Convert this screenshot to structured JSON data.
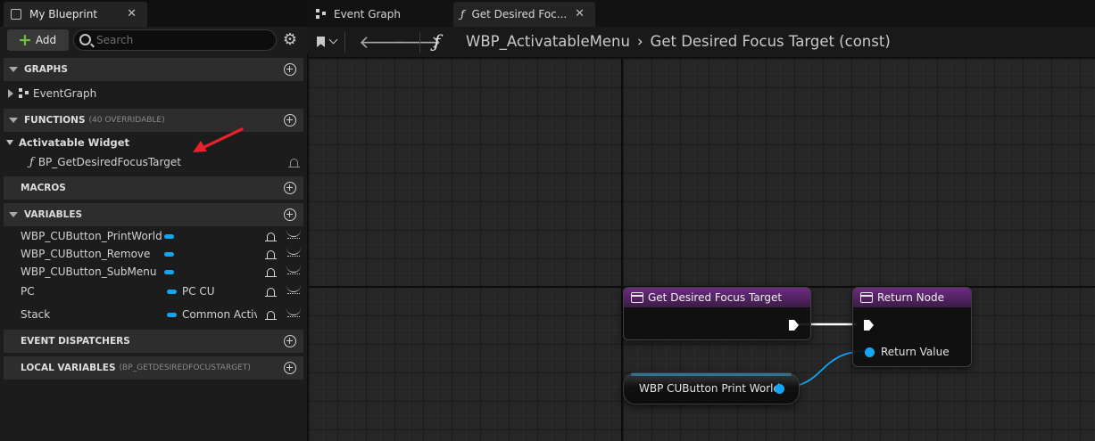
{
  "left_panel": {
    "tab_title": "My Blueprint",
    "tab_close": "✕",
    "add_label": "Add",
    "search_placeholder": "Search",
    "sections": {
      "graphs": {
        "title": "GRAPHS",
        "items": [
          "EventGraph"
        ]
      },
      "functions": {
        "title": "FUNCTIONS",
        "subtitle": "(40 OVERRIDABLE)",
        "category": "Activatable Widget",
        "items": [
          "BP_GetDesiredFocusTarget"
        ]
      },
      "macros": {
        "title": "MACROS"
      },
      "variables": {
        "title": "VARIABLES",
        "items": [
          {
            "name": "WBP_CUButton_PrintWorld",
            "type": ""
          },
          {
            "name": "WBP_CUButton_Remove",
            "type": ""
          },
          {
            "name": "WBP_CUButton_SubMenu",
            "type": ""
          },
          {
            "name": "PC",
            "type": "PC CU"
          },
          {
            "name": "Stack",
            "type": "Common Activ"
          }
        ]
      },
      "event_dispatchers": {
        "title": "EVENT DISPATCHERS"
      },
      "local_variables": {
        "title": "LOCAL VARIABLES",
        "subtitle": "(BP_GETDESIREDFOCUSTARGET)"
      }
    },
    "colors": {
      "annotation_arrow": "#e8222a",
      "variable_pill": "#12a6f2"
    }
  },
  "graph": {
    "tabs": [
      {
        "label": "Event Graph",
        "active": false
      },
      {
        "label": "Get Desired Foc...",
        "active": true
      }
    ],
    "tab_close": "✕",
    "breadcrumb": {
      "blueprint": "WBP_ActivatableMenu",
      "function": "Get Desired Focus Target (const)"
    },
    "nodes": {
      "entry": {
        "title": "Get Desired Focus Target"
      },
      "return": {
        "title": "Return Node",
        "pin_label": "Return Value"
      },
      "variable": {
        "label": "WBP CUButton Print World"
      }
    },
    "colors": {
      "function_header": "#6e2a82",
      "object_pin": "#14a6f5",
      "exec_wire": "#ffffff"
    }
  }
}
